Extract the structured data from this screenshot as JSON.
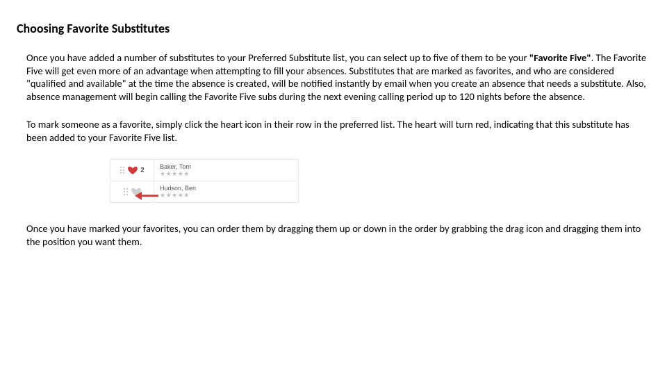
{
  "heading": "Choosing Favorite Substitutes",
  "para1_a": "Once you have added a number of substitutes to your Preferred Substitute list, you can select up to five of them to be your ",
  "para1_b": "\"Favorite Five\"",
  "para1_c": ". The Favorite Five will get even more of an advantage when attempting to fill your absences. Substitutes that are marked as favorites, and who are considered \"qualified and available\" at the time the absence is created, will be notified instantly by email when you create an absence that needs a substitute. Also, absence management will begin calling the Favorite Five subs during the next evening calling period up to 120 nights before the absence.",
  "para2": "To mark someone as a favorite, simply click the heart icon in their row in the preferred list. The heart will turn red, indicating that this substitute has been added to your Favorite Five list.",
  "para3": "Once you have marked your favorites, you can order them by dragging them up or down in the order by grabbing the drag icon and dragging them into the position you want them.",
  "figure": {
    "rows": [
      {
        "name": "Baker, Tom",
        "rank": "2",
        "fav": true
      },
      {
        "name": "Hudson, Ben",
        "rank": "",
        "fav": false
      }
    ],
    "stars": "★★★★★"
  }
}
